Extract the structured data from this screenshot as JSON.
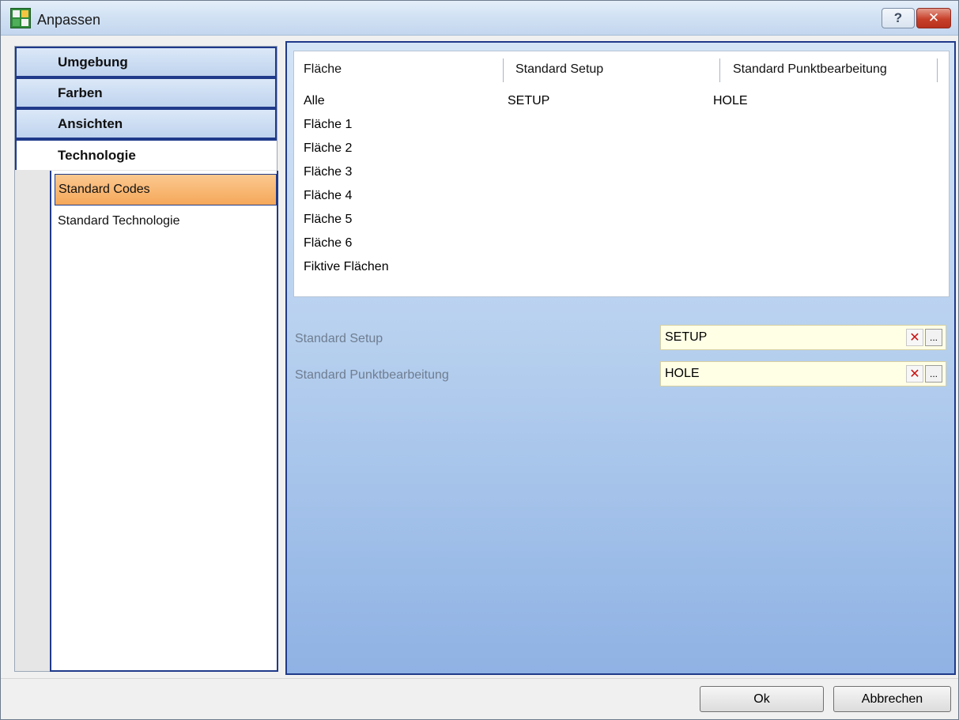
{
  "window": {
    "title": "Anpassen",
    "help_label": "?",
    "close_label": "✕"
  },
  "nav": {
    "tabs": [
      {
        "label": "Umgebung"
      },
      {
        "label": "Farben"
      },
      {
        "label": "Ansichten"
      },
      {
        "label": "Technologie",
        "active": true
      }
    ],
    "subitems": [
      {
        "label": "Standard Codes",
        "selected": true
      },
      {
        "label": "Standard Technologie"
      }
    ]
  },
  "list": {
    "columns": [
      "Fläche",
      "Standard Setup",
      "Standard Punktbearbeitung"
    ],
    "rows": [
      [
        "Alle",
        "SETUP",
        "HOLE"
      ],
      [
        "Fläche 1",
        "",
        ""
      ],
      [
        "Fläche 2",
        "",
        ""
      ],
      [
        "Fläche 3",
        "",
        ""
      ],
      [
        "Fläche 4",
        "",
        ""
      ],
      [
        "Fläche 5",
        "",
        ""
      ],
      [
        "Fläche 6",
        "",
        ""
      ],
      [
        "Fiktive Flächen",
        "",
        ""
      ]
    ]
  },
  "fields": {
    "setup": {
      "label": "Standard Setup",
      "value": "SETUP"
    },
    "punkt": {
      "label": "Standard Punktbearbeitung",
      "value": "HOLE"
    },
    "clear_glyph": "✕",
    "browse_glyph": "..."
  },
  "buttons": {
    "ok": "Ok",
    "cancel": "Abbrechen"
  },
  "colors": {
    "accent_border": "#1f3a8a",
    "selection": "#f5a85a",
    "field_bg": "#ffffe6"
  }
}
